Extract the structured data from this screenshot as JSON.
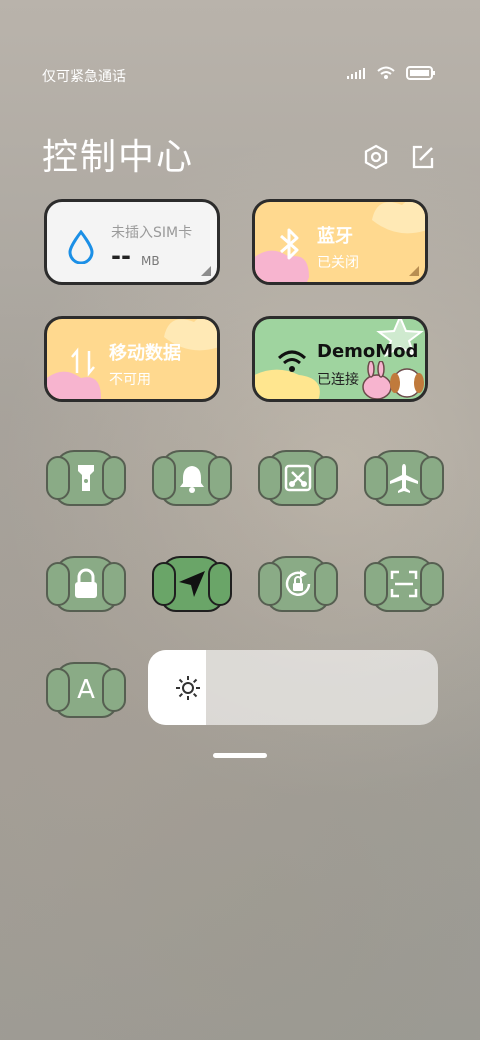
{
  "status": {
    "carrier": "仅可紧急通话"
  },
  "header": {
    "title": "控制中心"
  },
  "tiles": {
    "data_usage": {
      "title": "未插入SIM卡",
      "value": "--",
      "unit": "MB"
    },
    "bluetooth": {
      "title": "蓝牙",
      "subtitle": "已关闭"
    },
    "mobile_data": {
      "title": "移动数据",
      "subtitle": "不可用"
    },
    "wifi": {
      "title": "DemoMod",
      "subtitle": "已连接"
    }
  },
  "toggles": [
    {
      "name": "flashlight-icon",
      "active": false
    },
    {
      "name": "bell-icon",
      "active": false
    },
    {
      "name": "screenshot-icon",
      "active": false
    },
    {
      "name": "airplane-icon",
      "active": false
    },
    {
      "name": "lock-icon",
      "active": false
    },
    {
      "name": "location-icon",
      "active": true
    },
    {
      "name": "rotation-lock-icon",
      "active": false
    },
    {
      "name": "scan-icon",
      "active": false
    },
    {
      "name": "auto-brightness-icon",
      "active": false,
      "label": "A"
    }
  ],
  "brightness": {
    "level": 0.2
  },
  "colors": {
    "tile_green": "#8aab86",
    "tile_yellow": "#ffd98f",
    "tile_pink": "#f7b4cf",
    "tile_mint": "#9fd49f"
  }
}
